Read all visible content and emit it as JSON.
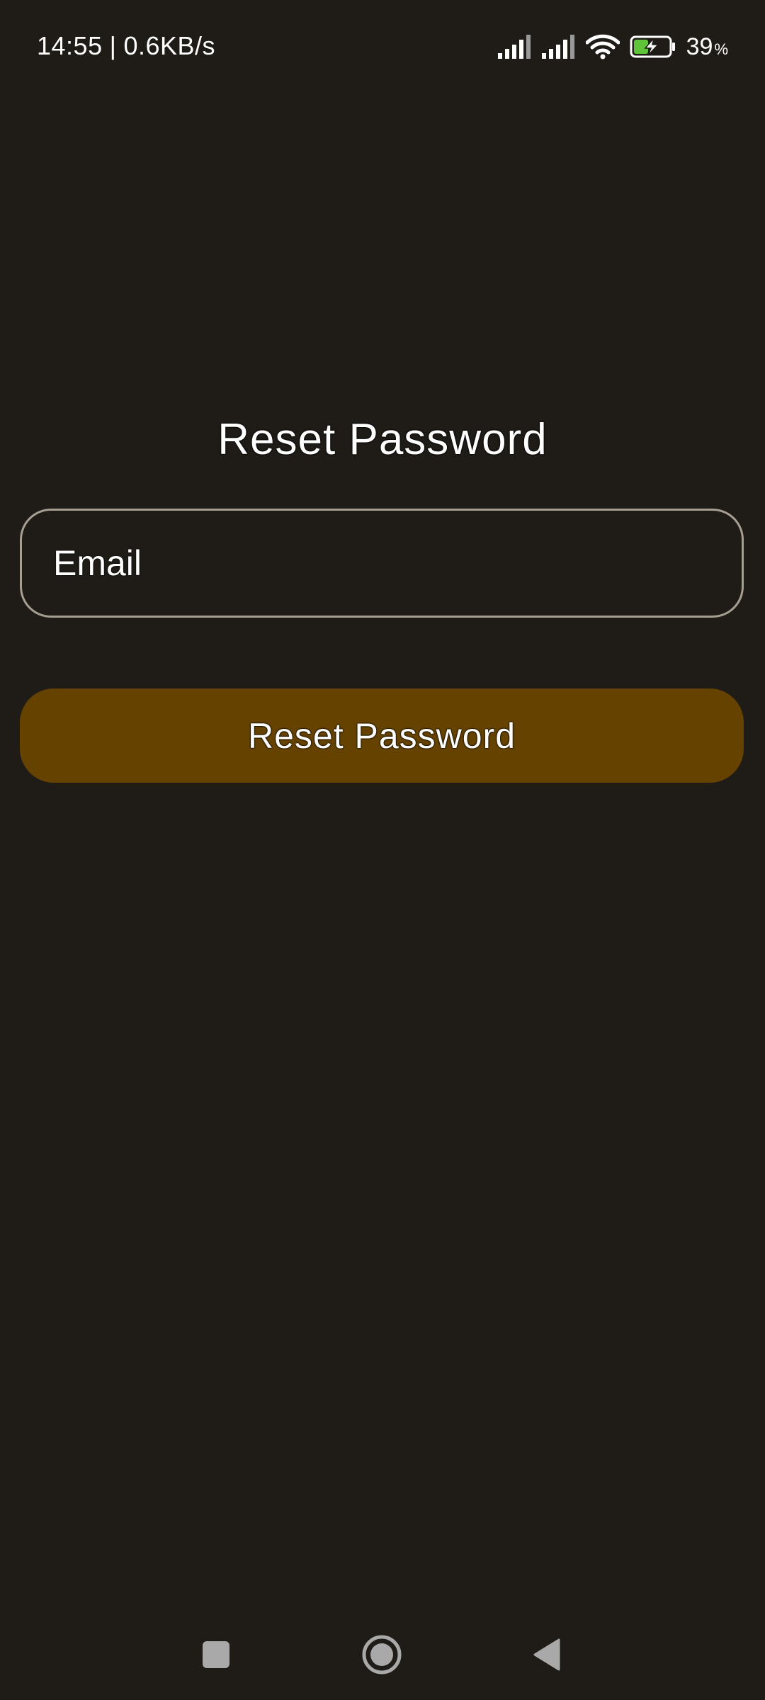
{
  "status_bar": {
    "time": "14:55",
    "separator": "|",
    "network_speed": "0.6KB/s",
    "battery_percent": "39",
    "battery_unit": "%",
    "icons": [
      "signal-icon",
      "signal-icon",
      "wifi-icon",
      "battery-charging-icon"
    ]
  },
  "reset_form": {
    "title": "Reset Password",
    "email_placeholder": "Email",
    "submit_label": "Reset Password"
  },
  "nav_bar": {
    "icons": [
      "recents-icon",
      "home-icon",
      "back-icon"
    ]
  },
  "colors": {
    "background": "#1f1c18",
    "button": "#654200",
    "field_border": "#a79e92",
    "battery_accent": "#5fc43a"
  }
}
